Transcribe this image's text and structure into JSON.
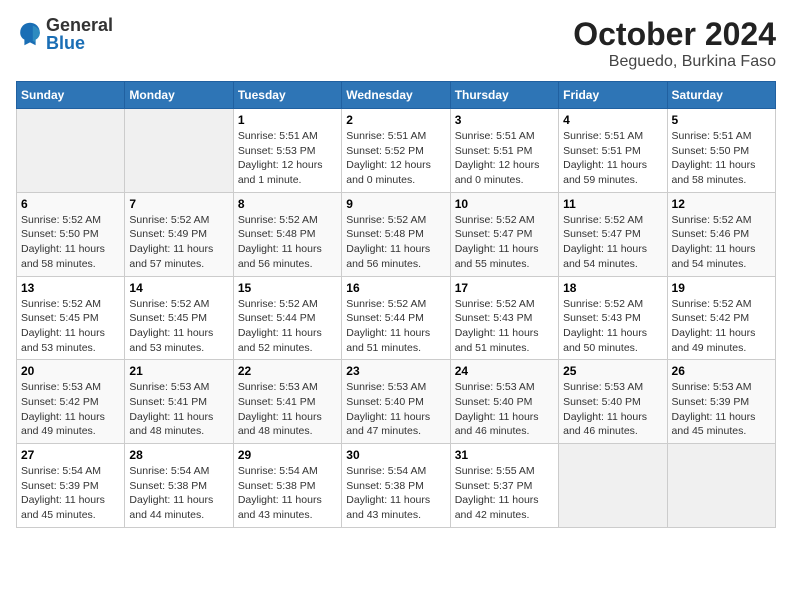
{
  "logo": {
    "general": "General",
    "blue": "Blue"
  },
  "title": "October 2024",
  "subtitle": "Beguedo, Burkina Faso",
  "days_of_week": [
    "Sunday",
    "Monday",
    "Tuesday",
    "Wednesday",
    "Thursday",
    "Friday",
    "Saturday"
  ],
  "weeks": [
    [
      {
        "day": "",
        "info": ""
      },
      {
        "day": "",
        "info": ""
      },
      {
        "day": "1",
        "info": "Sunrise: 5:51 AM\nSunset: 5:53 PM\nDaylight: 12 hours and 1 minute."
      },
      {
        "day": "2",
        "info": "Sunrise: 5:51 AM\nSunset: 5:52 PM\nDaylight: 12 hours and 0 minutes."
      },
      {
        "day": "3",
        "info": "Sunrise: 5:51 AM\nSunset: 5:51 PM\nDaylight: 12 hours and 0 minutes."
      },
      {
        "day": "4",
        "info": "Sunrise: 5:51 AM\nSunset: 5:51 PM\nDaylight: 11 hours and 59 minutes."
      },
      {
        "day": "5",
        "info": "Sunrise: 5:51 AM\nSunset: 5:50 PM\nDaylight: 11 hours and 58 minutes."
      }
    ],
    [
      {
        "day": "6",
        "info": "Sunrise: 5:52 AM\nSunset: 5:50 PM\nDaylight: 11 hours and 58 minutes."
      },
      {
        "day": "7",
        "info": "Sunrise: 5:52 AM\nSunset: 5:49 PM\nDaylight: 11 hours and 57 minutes."
      },
      {
        "day": "8",
        "info": "Sunrise: 5:52 AM\nSunset: 5:48 PM\nDaylight: 11 hours and 56 minutes."
      },
      {
        "day": "9",
        "info": "Sunrise: 5:52 AM\nSunset: 5:48 PM\nDaylight: 11 hours and 56 minutes."
      },
      {
        "day": "10",
        "info": "Sunrise: 5:52 AM\nSunset: 5:47 PM\nDaylight: 11 hours and 55 minutes."
      },
      {
        "day": "11",
        "info": "Sunrise: 5:52 AM\nSunset: 5:47 PM\nDaylight: 11 hours and 54 minutes."
      },
      {
        "day": "12",
        "info": "Sunrise: 5:52 AM\nSunset: 5:46 PM\nDaylight: 11 hours and 54 minutes."
      }
    ],
    [
      {
        "day": "13",
        "info": "Sunrise: 5:52 AM\nSunset: 5:45 PM\nDaylight: 11 hours and 53 minutes."
      },
      {
        "day": "14",
        "info": "Sunrise: 5:52 AM\nSunset: 5:45 PM\nDaylight: 11 hours and 53 minutes."
      },
      {
        "day": "15",
        "info": "Sunrise: 5:52 AM\nSunset: 5:44 PM\nDaylight: 11 hours and 52 minutes."
      },
      {
        "day": "16",
        "info": "Sunrise: 5:52 AM\nSunset: 5:44 PM\nDaylight: 11 hours and 51 minutes."
      },
      {
        "day": "17",
        "info": "Sunrise: 5:52 AM\nSunset: 5:43 PM\nDaylight: 11 hours and 51 minutes."
      },
      {
        "day": "18",
        "info": "Sunrise: 5:52 AM\nSunset: 5:43 PM\nDaylight: 11 hours and 50 minutes."
      },
      {
        "day": "19",
        "info": "Sunrise: 5:52 AM\nSunset: 5:42 PM\nDaylight: 11 hours and 49 minutes."
      }
    ],
    [
      {
        "day": "20",
        "info": "Sunrise: 5:53 AM\nSunset: 5:42 PM\nDaylight: 11 hours and 49 minutes."
      },
      {
        "day": "21",
        "info": "Sunrise: 5:53 AM\nSunset: 5:41 PM\nDaylight: 11 hours and 48 minutes."
      },
      {
        "day": "22",
        "info": "Sunrise: 5:53 AM\nSunset: 5:41 PM\nDaylight: 11 hours and 48 minutes."
      },
      {
        "day": "23",
        "info": "Sunrise: 5:53 AM\nSunset: 5:40 PM\nDaylight: 11 hours and 47 minutes."
      },
      {
        "day": "24",
        "info": "Sunrise: 5:53 AM\nSunset: 5:40 PM\nDaylight: 11 hours and 46 minutes."
      },
      {
        "day": "25",
        "info": "Sunrise: 5:53 AM\nSunset: 5:40 PM\nDaylight: 11 hours and 46 minutes."
      },
      {
        "day": "26",
        "info": "Sunrise: 5:53 AM\nSunset: 5:39 PM\nDaylight: 11 hours and 45 minutes."
      }
    ],
    [
      {
        "day": "27",
        "info": "Sunrise: 5:54 AM\nSunset: 5:39 PM\nDaylight: 11 hours and 45 minutes."
      },
      {
        "day": "28",
        "info": "Sunrise: 5:54 AM\nSunset: 5:38 PM\nDaylight: 11 hours and 44 minutes."
      },
      {
        "day": "29",
        "info": "Sunrise: 5:54 AM\nSunset: 5:38 PM\nDaylight: 11 hours and 43 minutes."
      },
      {
        "day": "30",
        "info": "Sunrise: 5:54 AM\nSunset: 5:38 PM\nDaylight: 11 hours and 43 minutes."
      },
      {
        "day": "31",
        "info": "Sunrise: 5:55 AM\nSunset: 5:37 PM\nDaylight: 11 hours and 42 minutes."
      },
      {
        "day": "",
        "info": ""
      },
      {
        "day": "",
        "info": ""
      }
    ]
  ]
}
